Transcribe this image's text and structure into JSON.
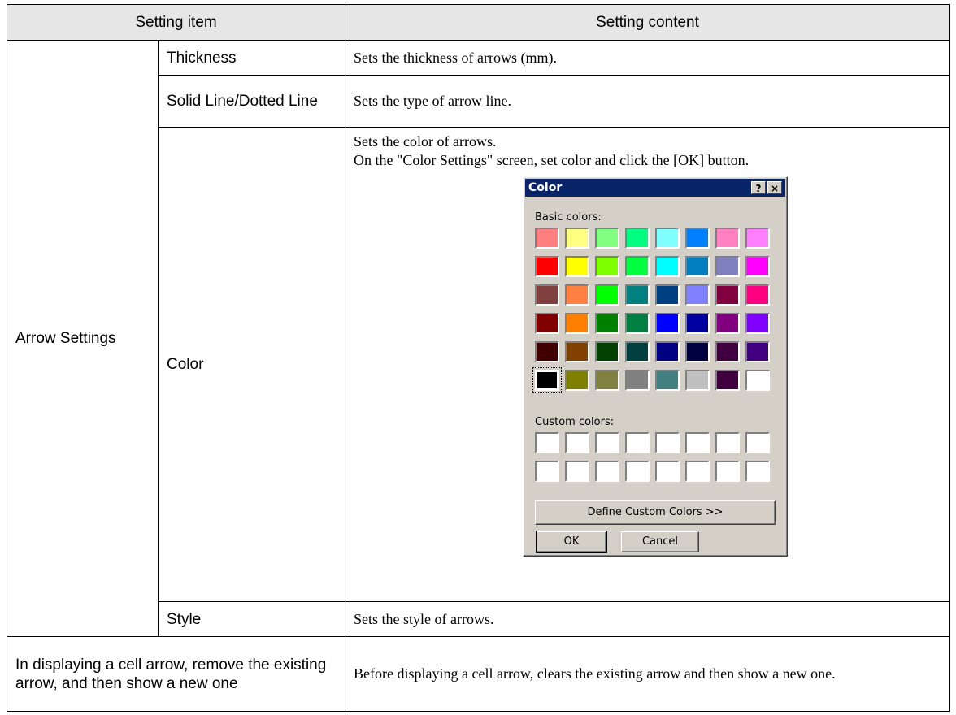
{
  "table": {
    "headers": [
      "Setting item",
      "Setting content"
    ],
    "group_label": "Arrow Settings",
    "rows": [
      {
        "item": "Thickness",
        "content": "Sets the thickness of arrows (mm)."
      },
      {
        "item": "Solid Line/Dotted Line",
        "content": "Sets the type of arrow line."
      },
      {
        "item": "Color",
        "content_line1": "Sets the color of arrows.",
        "content_line2": "On the \"Color Settings\" screen, set color and click the [OK] button."
      },
      {
        "item": "Style",
        "content": "Sets the style of arrows."
      }
    ],
    "last_row": {
      "item": "In displaying a cell arrow, remove the existing arrow, and then show a new one",
      "content": "Before displaying a cell arrow, clears the existing arrow and then show a new one."
    }
  },
  "dialog": {
    "title": "Color",
    "help_glyph": "?",
    "close_glyph": "×",
    "basic_label": "Basic colors:",
    "custom_label": "Custom colors:",
    "define_button": "Define Custom Colors >>",
    "ok_button": "OK",
    "cancel_button": "Cancel",
    "basic_colors": [
      "#ff8080",
      "#ffff80",
      "#80ff80",
      "#00ff80",
      "#80ffff",
      "#0080ff",
      "#ff80c0",
      "#ff80ff",
      "#ff0000",
      "#ffff00",
      "#80ff00",
      "#00ff40",
      "#00ffff",
      "#0080c0",
      "#8080c0",
      "#ff00ff",
      "#804040",
      "#ff8040",
      "#00ff00",
      "#008080",
      "#004080",
      "#8080ff",
      "#800040",
      "#ff0080",
      "#800000",
      "#ff8000",
      "#008000",
      "#008040",
      "#0000ff",
      "#0000a0",
      "#800080",
      "#8000ff",
      "#400000",
      "#804000",
      "#004000",
      "#004040",
      "#000080",
      "#000040",
      "#400040",
      "#400080",
      "#000000",
      "#808000",
      "#808040",
      "#808080",
      "#408080",
      "#c0c0c0",
      "#400040",
      "#ffffff"
    ],
    "selected_index": 40,
    "custom_colors": [
      "#ffffff",
      "#ffffff",
      "#ffffff",
      "#ffffff",
      "#ffffff",
      "#ffffff",
      "#ffffff",
      "#ffffff",
      "#ffffff",
      "#ffffff",
      "#ffffff",
      "#ffffff",
      "#ffffff",
      "#ffffff",
      "#ffffff",
      "#ffffff"
    ]
  }
}
